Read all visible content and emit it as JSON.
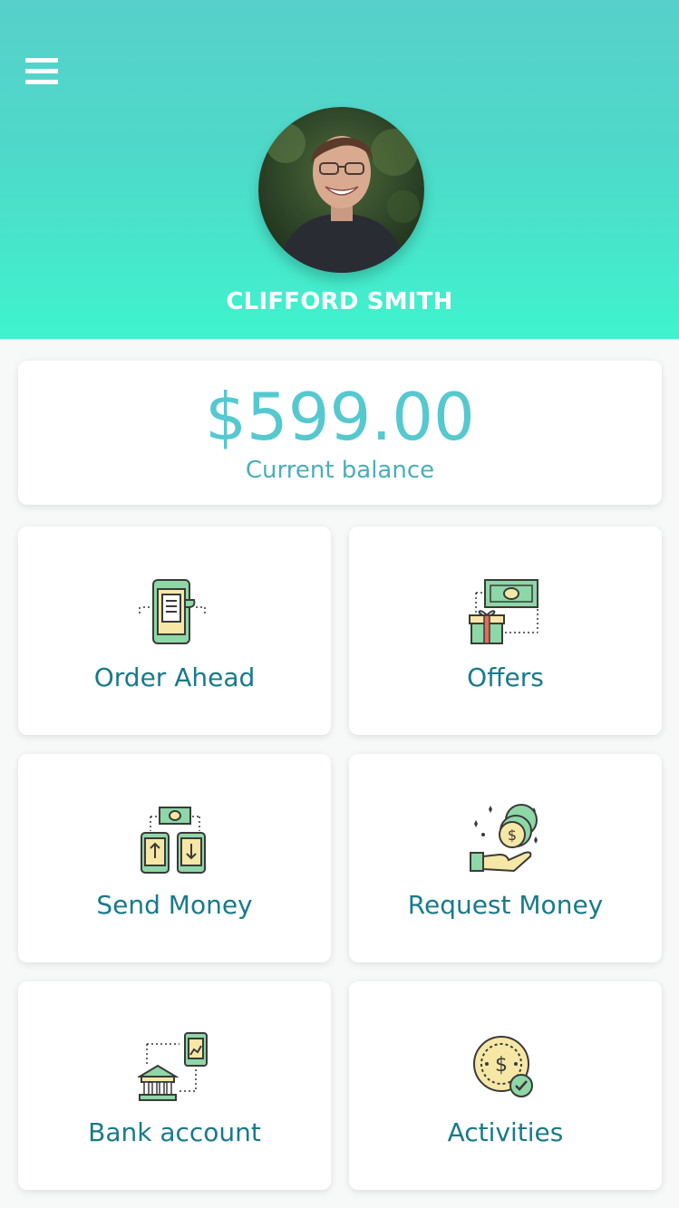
{
  "colors": {
    "header_gradient_top": "#57d0ca",
    "header_gradient_bottom": "#3ff3cd",
    "balance_text": "#56c8cf",
    "tile_label": "#187a8a",
    "icon_green": "#8ed7a6",
    "icon_yellow": "#f6e7a6",
    "icon_outline": "#3a3a3a"
  },
  "header": {
    "menu_icon": "hamburger-menu-icon",
    "avatar_alt": "user avatar photo",
    "user_name": "CLIFFORD SMITH"
  },
  "balance": {
    "amount": "$599.00",
    "label": "Current balance"
  },
  "tiles": [
    {
      "label": "Order Ahead",
      "icon": "phone-receipt-icon"
    },
    {
      "label": "Offers",
      "icon": "cash-gift-icon"
    },
    {
      "label": "Send Money",
      "icon": "phones-transfer-icon"
    },
    {
      "label": "Request Money",
      "icon": "hand-coins-icon"
    },
    {
      "label": "Bank account",
      "icon": "bank-phone-icon"
    },
    {
      "label": "Activities",
      "icon": "coin-check-icon"
    }
  ]
}
